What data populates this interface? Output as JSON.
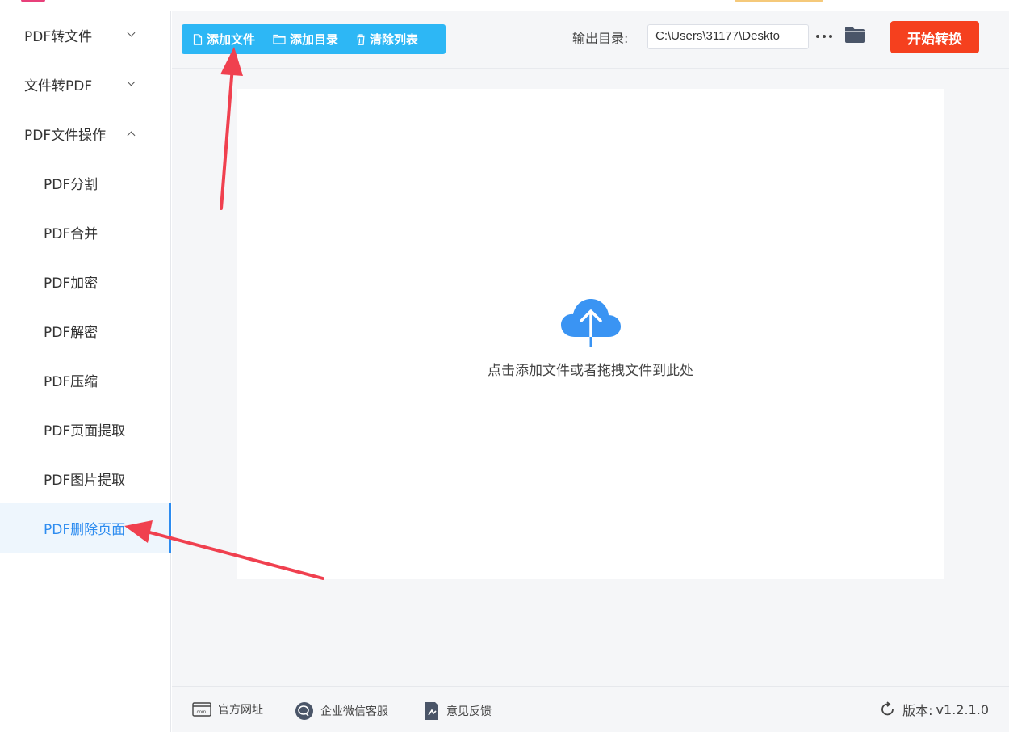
{
  "sidebar": {
    "groups": [
      {
        "label": "PDF转文件"
      },
      {
        "label": "文件转PDF"
      },
      {
        "label": "PDF文件操作"
      }
    ],
    "items": [
      {
        "label": "PDF分割"
      },
      {
        "label": "PDF合并"
      },
      {
        "label": "PDF加密"
      },
      {
        "label": "PDF解密"
      },
      {
        "label": "PDF压缩"
      },
      {
        "label": "PDF页面提取"
      },
      {
        "label": "PDF图片提取"
      },
      {
        "label": "PDF删除页面"
      }
    ],
    "active_item": "PDF删除页面"
  },
  "toolbar": {
    "add_file": "添加文件",
    "add_folder": "添加目录",
    "clear_list": "清除列表",
    "output_label": "输出目录:",
    "output_path": "C:\\Users\\31177\\Deskto",
    "start": "开始转换"
  },
  "dropzone": {
    "hint": "点击添加文件或者拖拽文件到此处"
  },
  "footer": {
    "website": "官方网址",
    "wechat": "企业微信客服",
    "feedback": "意见反馈",
    "version_label": "版本:",
    "version_value": "v1.2.1.0"
  },
  "colors": {
    "accent_blue": "#2d8cf0",
    "toolbar_blue": "#2db7f5",
    "start_red": "#f5401e",
    "upload_blue": "#3a94f3",
    "arrow_red": "#f0404f"
  }
}
